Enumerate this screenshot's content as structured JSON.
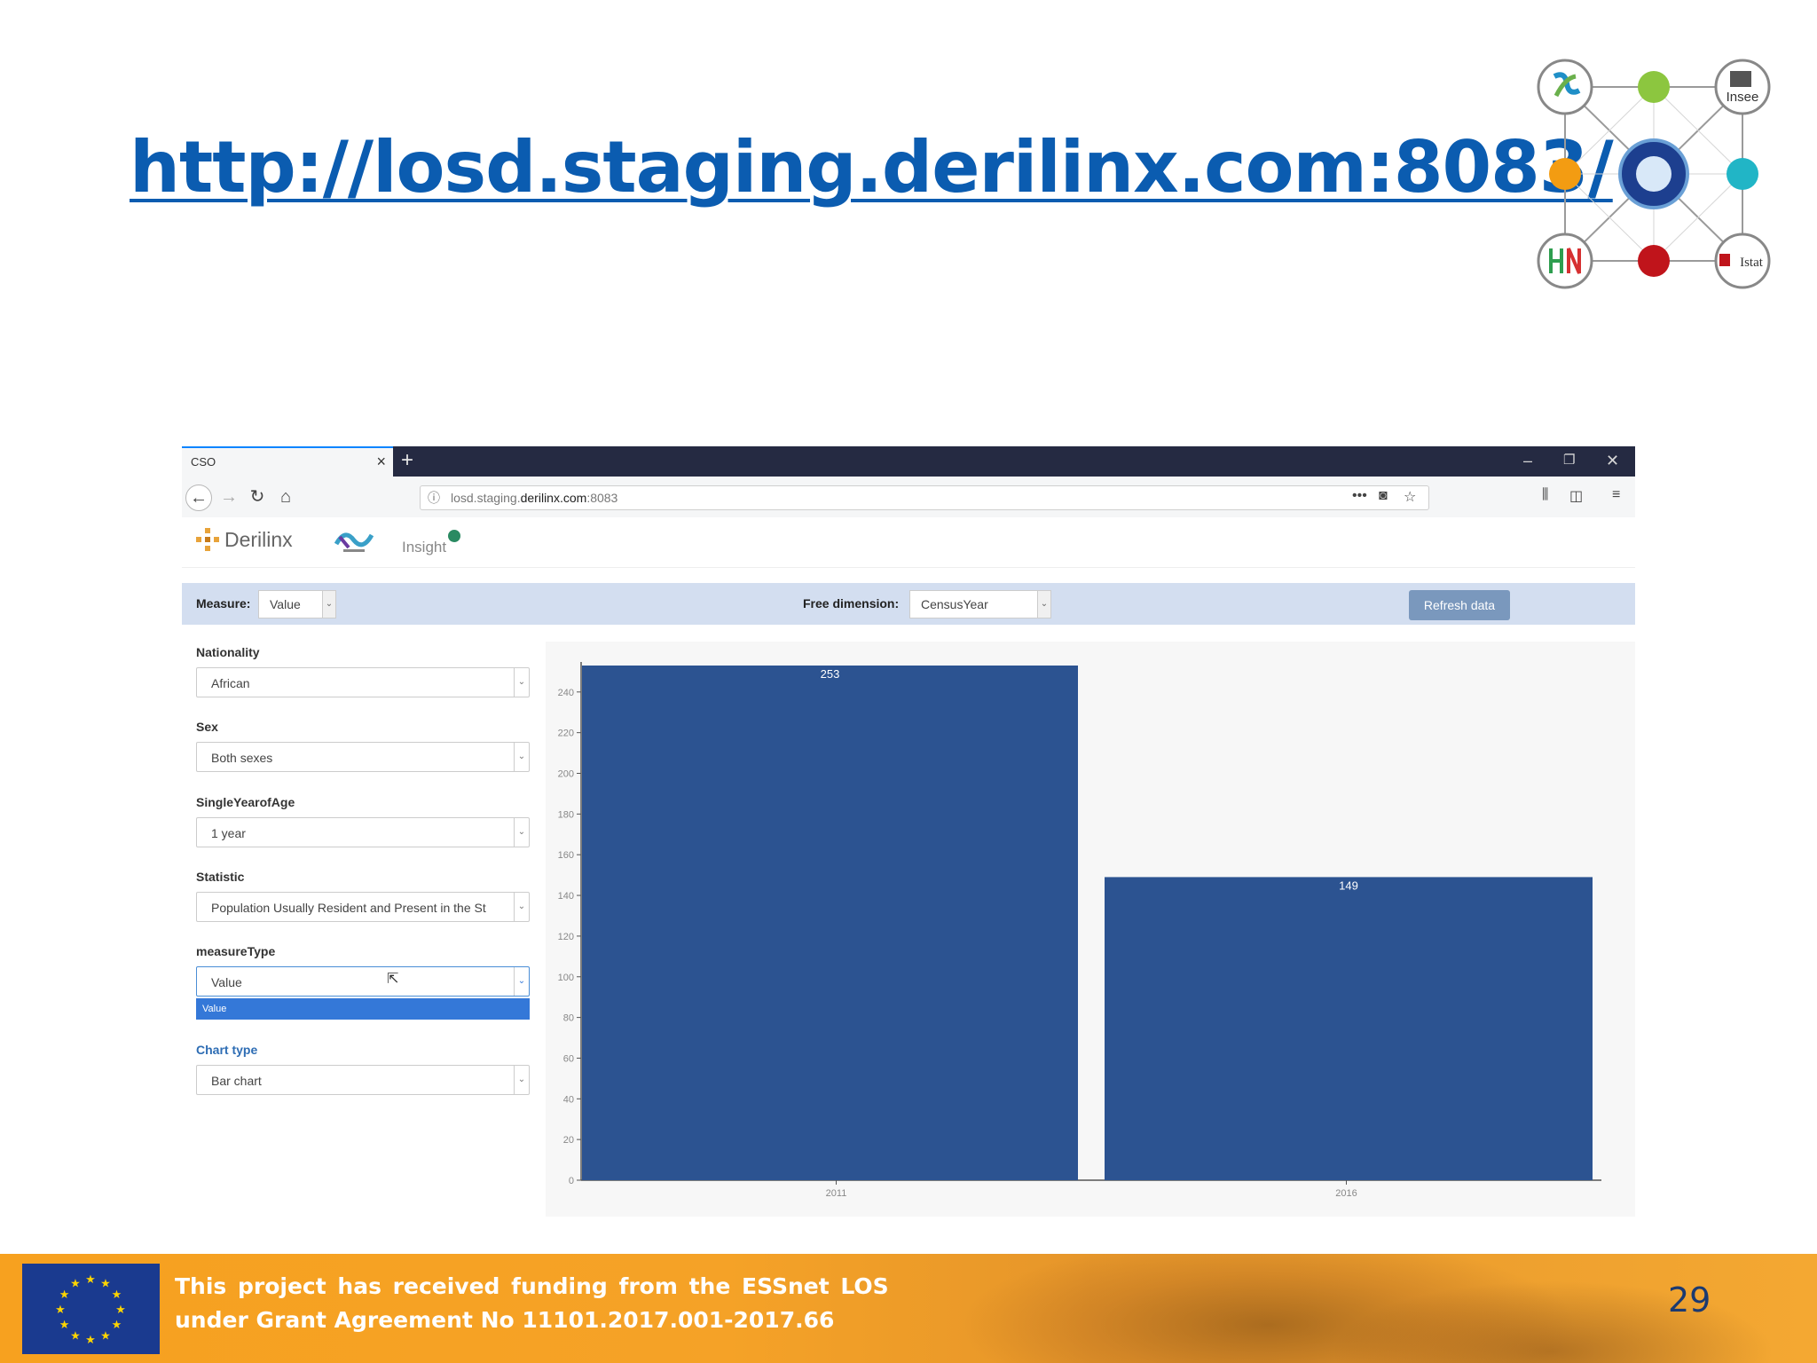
{
  "slide": {
    "url_heading": "http://losd.staging.derilinx.com:8083/",
    "partner_logos": {
      "insee": "Insee",
      "istat": "Istat"
    },
    "footer_text_line1": "This project has received funding from the ESSnet LOS",
    "footer_text_line2": "under Grant Agreement No 11101.2017.001-2017.66",
    "page_number": "29"
  },
  "browser": {
    "tab_title": "CSO",
    "tab_close": "×",
    "new_tab": "+",
    "window_controls": {
      "minimize": "–",
      "restore": "❐",
      "close": "✕"
    },
    "url_prefix": "losd.staging.",
    "url_domain": "derilinx.com",
    "url_suffix": ":8083"
  },
  "app": {
    "brand_name": "Derilinx",
    "insight_label": "Insight",
    "controls": {
      "measure_label": "Measure:",
      "measure_value": "Value",
      "free_dimension_label": "Free dimension:",
      "free_dimension_value": "CensusYear",
      "refresh_label": "Refresh data"
    },
    "filters": [
      {
        "label": "Nationality",
        "value": "African"
      },
      {
        "label": "Sex",
        "value": "Both sexes"
      },
      {
        "label": "SingleYearofAge",
        "value": "1 year"
      },
      {
        "label": "Statistic",
        "value": "Population Usually Resident and Present in the St"
      },
      {
        "label": "measureType",
        "value": "Value"
      }
    ],
    "dropdown_option": "Value",
    "chart_type_label": "Chart type",
    "chart_type_value": "Bar chart"
  },
  "chart_data": {
    "type": "bar",
    "categories": [
      "2011",
      "2016"
    ],
    "values": [
      253,
      149
    ],
    "ylim": [
      0,
      253
    ],
    "yticks": [
      0,
      20,
      40,
      60,
      80,
      100,
      120,
      140,
      160,
      180,
      200,
      220,
      240
    ],
    "bar_color": "#2c5391",
    "data_labels": true
  },
  "colors": {
    "url_blue": "#0b5cb0",
    "browser_titlebar": "#252a42",
    "controls_bar": "#d3def0",
    "refresh_button": "#7a98bd",
    "dropdown_highlight": "#3478d8",
    "footer_orange": "#f7a11f"
  }
}
